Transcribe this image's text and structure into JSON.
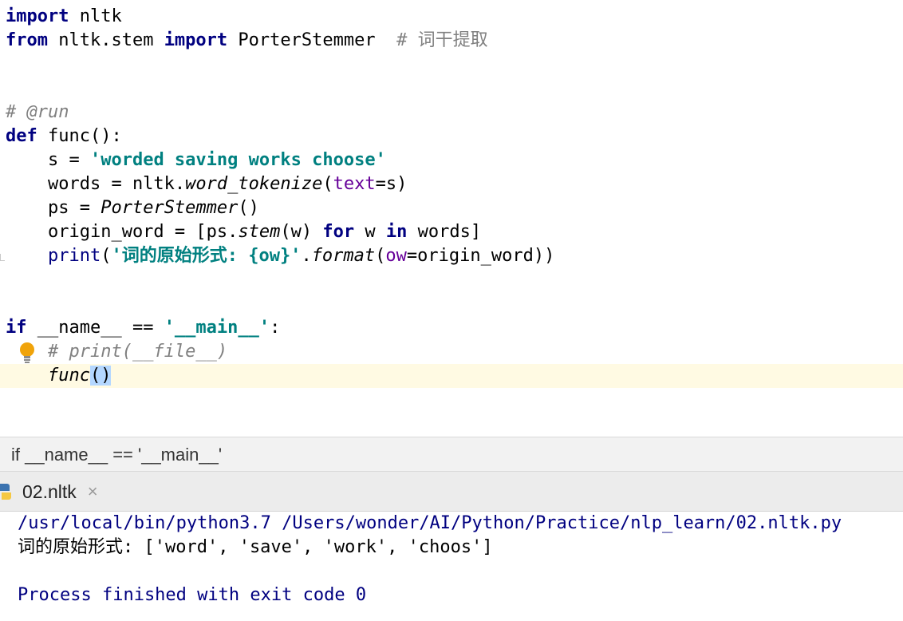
{
  "editor": {
    "line1": {
      "kw": "import",
      "rest": " nltk"
    },
    "line2": {
      "kw1": "from",
      "mid": " nltk.stem ",
      "kw2": "import",
      "rest": " PorterStemmer  ",
      "comment": "# 词干提取"
    },
    "line3": {
      "comment": "# @run"
    },
    "line4": {
      "kw": "def",
      "rest": " func():"
    },
    "line5": {
      "pre": "    s = ",
      "str": "'worded saving works choose'"
    },
    "line6": {
      "pre": "    words = nltk.",
      "fn": "word_tokenize",
      "open": "(",
      "param": "text",
      "post": "=s)"
    },
    "line7": {
      "pre": "    ps = ",
      "fn": "PorterStemmer",
      "post": "()"
    },
    "line8": {
      "pre": "    origin_word = [ps.",
      "fn": "stem",
      "mid": "(w) ",
      "kw1": "for",
      "mid2": " w ",
      "kw2": "in",
      "post": " words]"
    },
    "line9": {
      "pre": "    ",
      "builtin": "print",
      "open": "(",
      "str": "'词的原始形式: {ow}'",
      "dot": ".",
      "fn": "format",
      "open2": "(",
      "param": "ow",
      "post": "=origin_word))"
    },
    "line10": {
      "kw": "if",
      "mid": " __name__ == ",
      "str": "'__main__'",
      "post": ":"
    },
    "line11": {
      "pre": "    ",
      "comment": "# print(__file__)"
    },
    "line12": {
      "pre": "    ",
      "fn": "func",
      "braces": "()"
    }
  },
  "breadcrumb": {
    "text": "if __name__ == '__main__'"
  },
  "run_tab": {
    "label": "02.nltk",
    "close": "×",
    "icon": "python-icon"
  },
  "console": {
    "command": "/usr/local/bin/python3.7 /Users/wonder/AI/Python/Practice/nlp_learn/02.nltk.py",
    "output": "词的原始形式: ['word', 'save', 'work', 'choos']",
    "exit": "Process finished with exit code 0"
  },
  "colors": {
    "keyword": "#000080",
    "string": "#008080",
    "comment": "#808080",
    "param": "#660099",
    "caret_line": "#fffae3"
  }
}
